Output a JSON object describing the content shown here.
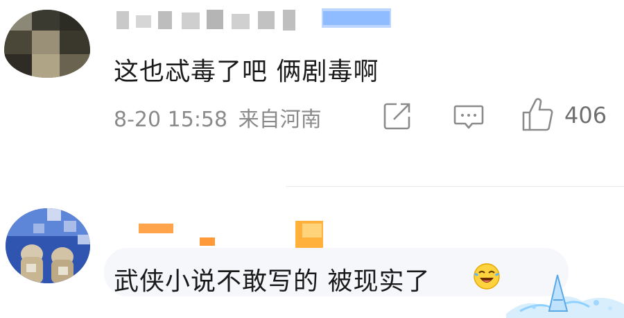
{
  "comments": [
    {
      "text": "这也忒毒了吧 俩剧毒啊",
      "date": "8-20",
      "time": "15:58",
      "location": "来自河南",
      "likes": "406"
    },
    {
      "text": "武侠小说不敢写的 被现实了",
      "emoji": "laughing-crying-emoji"
    }
  ],
  "icons": {
    "share": "share-icon",
    "comment": "comment-icon",
    "like": "thumbs-up-icon"
  },
  "colors": {
    "text": "#1a1a1a",
    "meta": "#8a8a8a",
    "badge_blue": "#7fb3ff",
    "badge_orange": "#ff9a2e"
  }
}
